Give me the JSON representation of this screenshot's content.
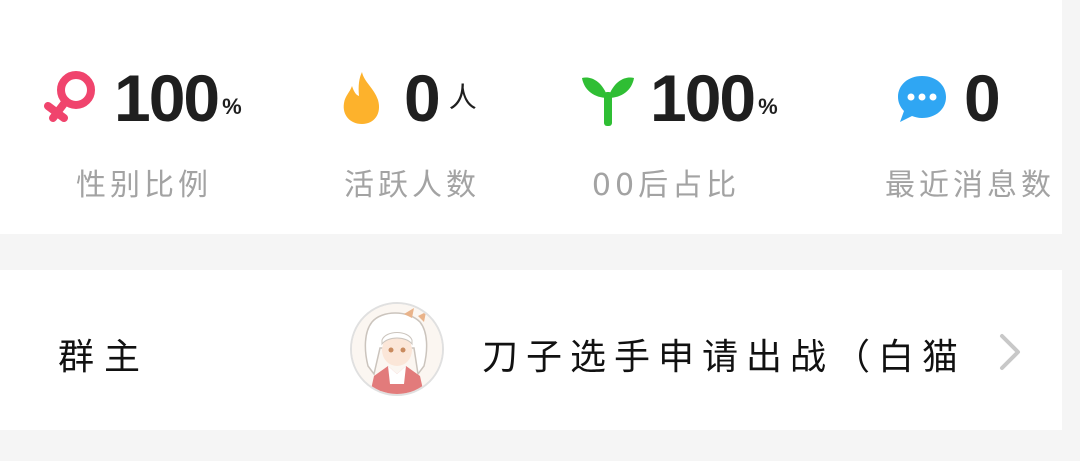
{
  "stats": [
    {
      "value": "100",
      "unit": "%",
      "label": "性别比例",
      "icon": "female-gender-icon",
      "color": "#f0446d"
    },
    {
      "value": "0",
      "unit": "人",
      "label": "活跃人数",
      "icon": "flame-icon",
      "color": "#fdb22c"
    },
    {
      "value": "100",
      "unit": "%",
      "label": "00后占比",
      "icon": "sprout-icon",
      "color": "#2fbe34"
    },
    {
      "value": "0",
      "unit": "",
      "label": "最近消息数",
      "icon": "chat-bubble-icon",
      "color": "#2fa6f3"
    }
  ],
  "owner": {
    "label": "群主",
    "name": "刀子选手申请出战（白猫",
    "avatar_icon": "anime-avatar-icon"
  }
}
